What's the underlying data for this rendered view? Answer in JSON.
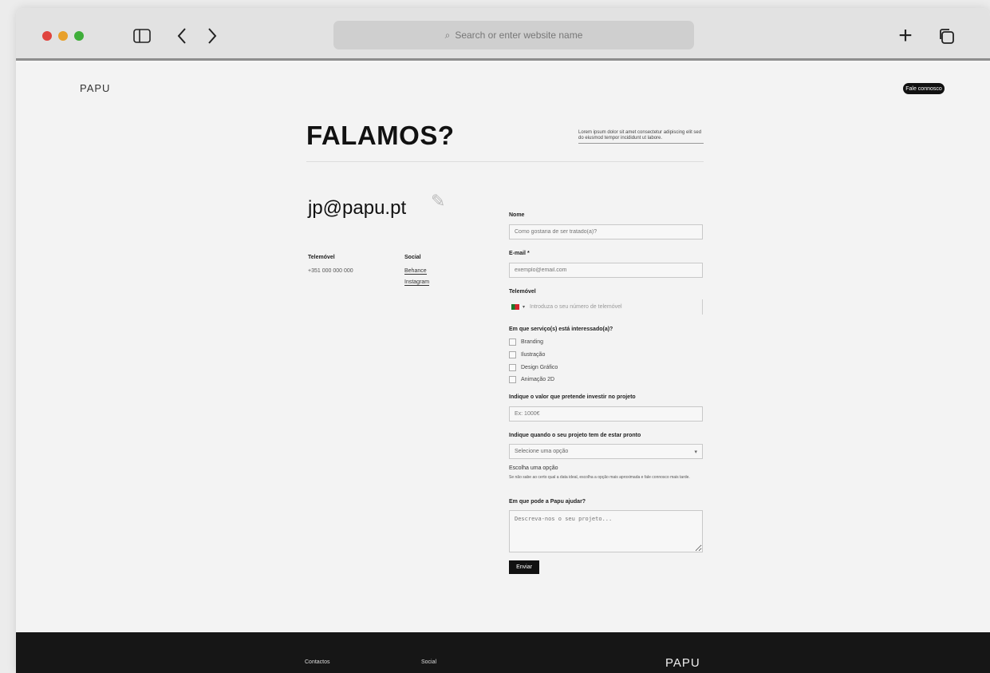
{
  "browser": {
    "address_placeholder": "Search or enter website name"
  },
  "site": {
    "logo": "PAPU",
    "cta": "Fale connosco"
  },
  "hero": {
    "title": "FALAMOS?",
    "intro": "Lorem ipsum dolor sit amet consectetur adipiscing elit sed do eiusmod tempor incididunt ut labore."
  },
  "contact": {
    "email": "jp@papu.pt",
    "col1_label": "Telemóvel",
    "col1_value": "+351 000 000 000",
    "col2_label": "Social",
    "col2_links": [
      "Behance",
      "Instagram"
    ]
  },
  "form": {
    "name_label": "Nome",
    "name_placeholder": "Como gostaria de ser tratado(a)?",
    "email_label": "E-mail *",
    "email_placeholder": "exemplo@email.com",
    "phone_label": "Telemóvel",
    "phone_placeholder": "Introduza o seu número de telemóvel",
    "interest_label": "Em que serviço(s) está interessado(a)?",
    "options": [
      "Branding",
      "Ilustração",
      "Design Gráfico",
      "Animação 2D"
    ],
    "budget_label": "Indique o valor que pretende investir no projeto",
    "budget_placeholder": "Ex: 1000€",
    "deadline_label": "Indique quando o seu projeto tem de estar pronto",
    "deadline_value": "Selecione uma opção",
    "note_title": "Escolha uma opção",
    "note_text": "Se não sabe ao certo qual a data ideal, escolha a opção mais aproximada e fale connosco mais tarde.",
    "message_label": "Em que pode a Papu ajudar?",
    "message_placeholder": "Descreva-nos o seu projeto...",
    "submit": "Enviar"
  },
  "footer": {
    "col1": "Contactos",
    "col2": "Social",
    "logo": "PAPU"
  }
}
